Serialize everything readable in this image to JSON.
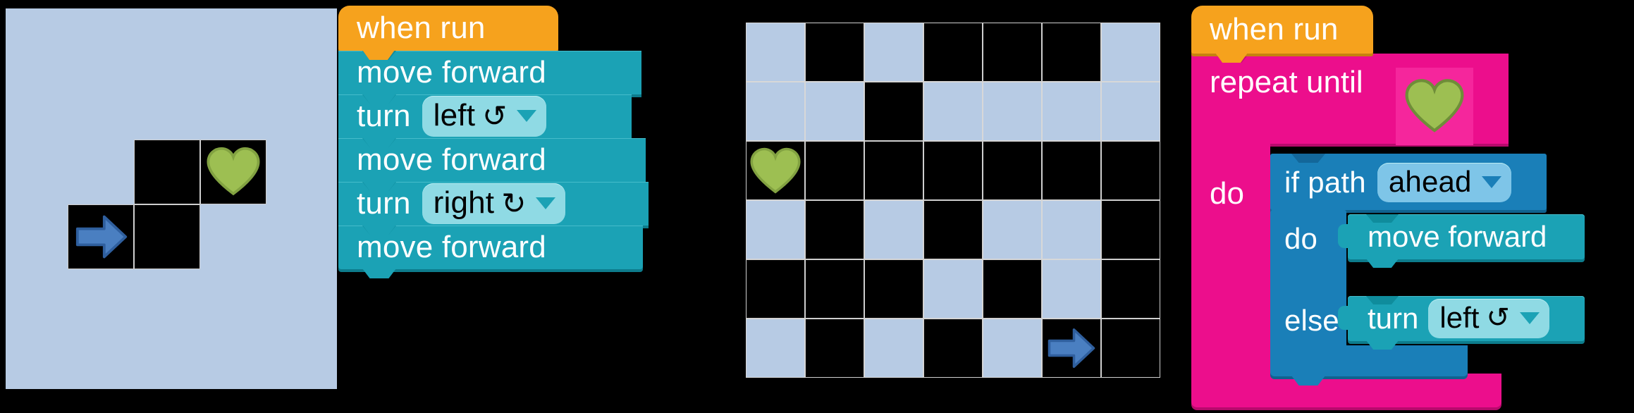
{
  "theme": {
    "background": "#000000",
    "maze_path": "#b7cbe4",
    "maze_wall": "#000000",
    "grid_line": "#cfcfcf",
    "hat_block": "#f6a21d",
    "action_block": "#1ba2b5",
    "loop_block": "#ec0e8c",
    "logic_block": "#1a7fb8",
    "dropdown_pill": "#8fdae4",
    "dropdown_pill_blue": "#7ec5e8",
    "heart": "#9dbf52",
    "robot_arrow": "#4a7fc1"
  },
  "left_panel": {
    "name": "simple-maze-puzzle",
    "maze": {
      "cols": 3,
      "rows": 2,
      "cells": [
        {
          "col": 1,
          "row": 0,
          "type": "open"
        },
        {
          "col": 2,
          "row": 0,
          "type": "open",
          "item": "heart"
        },
        {
          "col": 0,
          "row": 1,
          "type": "open",
          "item": "robot"
        },
        {
          "col": 1,
          "row": 1,
          "type": "open"
        }
      ],
      "robot": {
        "col": 0,
        "row": 1,
        "facing": "right"
      },
      "goal": {
        "col": 2,
        "row": 0,
        "icon": "heart-icon"
      }
    },
    "program": {
      "hat_label": "when run",
      "blocks": [
        {
          "type": "move",
          "label": "move forward"
        },
        {
          "type": "turn",
          "label": "turn",
          "direction": "left",
          "rotation_icon": "↺",
          "caret": "▼"
        },
        {
          "type": "move",
          "label": "move forward"
        },
        {
          "type": "turn",
          "label": "turn",
          "direction": "right",
          "rotation_icon": "↻",
          "caret": "▼"
        },
        {
          "type": "move",
          "label": "move forward"
        }
      ]
    }
  },
  "right_panel": {
    "name": "loop-maze-puzzle",
    "maze": {
      "cols": 7,
      "rows": 6,
      "grid": [
        [
          "path",
          "wall",
          "path",
          "wall",
          "wall",
          "wall",
          "path"
        ],
        [
          "path",
          "path",
          "wall",
          "path",
          "path",
          "path",
          "path"
        ],
        [
          "wall",
          "wall",
          "wall",
          "wall",
          "wall",
          "wall",
          "wall"
        ],
        [
          "path",
          "wall",
          "path",
          "wall",
          "path",
          "path",
          "wall"
        ],
        [
          "wall",
          "wall",
          "wall",
          "path",
          "wall",
          "path",
          "wall"
        ],
        [
          "path",
          "wall",
          "path",
          "wall",
          "path",
          "wall",
          "wall"
        ]
      ],
      "robot": {
        "col": 5,
        "row": 5,
        "facing": "right"
      },
      "goal": {
        "col": 0,
        "row": 2,
        "icon": "heart-icon"
      }
    },
    "program": {
      "hat_label": "when run",
      "loop": {
        "label": "repeat until",
        "condition_icon": "heart-icon",
        "do_label": "do",
        "body": {
          "type": "if-else",
          "if_label": "if path",
          "if_dropdown_value": "ahead",
          "if_dropdown_caret": "▼",
          "do_label": "do",
          "do_block": {
            "label": "move forward"
          },
          "else_label": "else",
          "else_block": {
            "label": "turn",
            "direction": "left",
            "rotation_icon": "↺",
            "caret": "▼"
          }
        }
      }
    }
  }
}
